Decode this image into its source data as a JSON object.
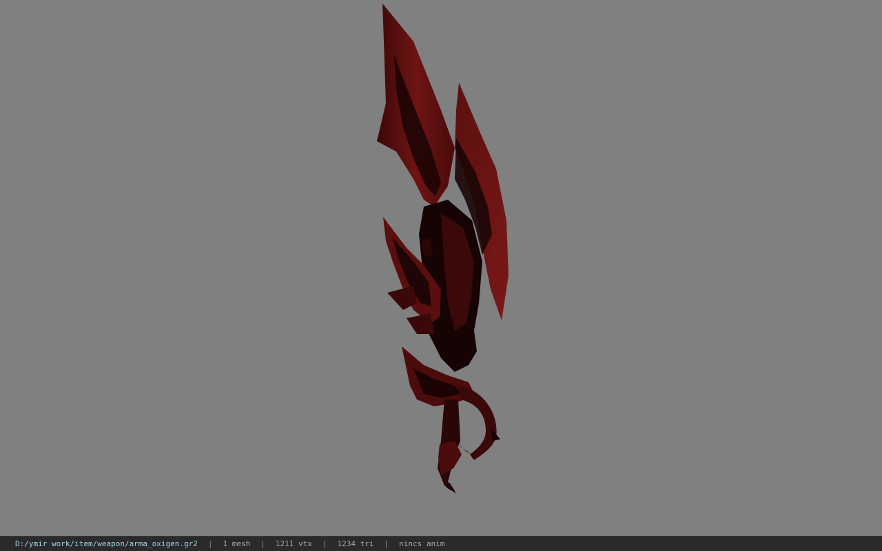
{
  "viewport": {
    "background": "#808080",
    "model": {
      "description_icon": "sword-model-icon",
      "colors": {
        "blade_red": "#6b1212",
        "blade_dark": "#3a0707",
        "edge_highlight": "#7a1818",
        "shadow": "#120303"
      }
    }
  },
  "statusbar": {
    "file_path": "D:/ymir work/item/weapon/arma_oxigen.gr2",
    "separator": "|",
    "mesh_count": "1 mesh",
    "vertex_count": "1211 vtx",
    "triangle_count": "1234 tri",
    "anim_status": "nincs anim"
  }
}
